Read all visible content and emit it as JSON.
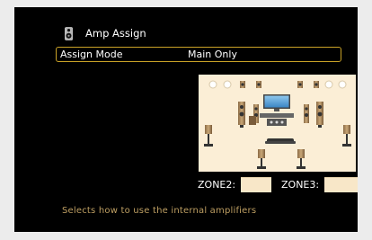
{
  "header": {
    "title": "Amp Assign",
    "icon": "speaker-icon"
  },
  "setting": {
    "label": "Assign Mode",
    "value": "Main Only"
  },
  "zones": {
    "zone2_label": "ZONE2:",
    "zone3_label": "ZONE3:"
  },
  "footer": {
    "description": "Selects how to use the internal amplifiers"
  },
  "colors": {
    "accent": "#c9a227",
    "diagram_bg": "#fbeed6",
    "description": "#bd9e62"
  }
}
